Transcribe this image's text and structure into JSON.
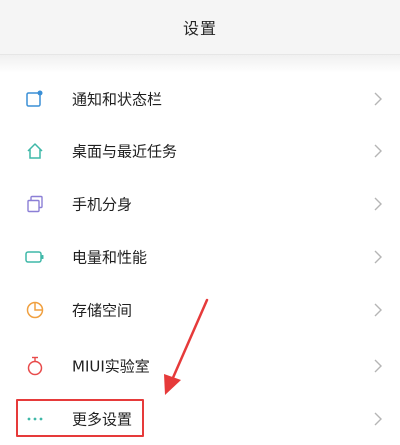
{
  "header": {
    "title": "设置"
  },
  "items": [
    {
      "label": "通知和状态栏",
      "icon": "notification-square-icon"
    },
    {
      "label": "桌面与最近任务",
      "icon": "home-icon"
    },
    {
      "label": "手机分身",
      "icon": "dual-copy-icon"
    },
    {
      "label": "电量和性能",
      "icon": "battery-icon"
    },
    {
      "label": "存储空间",
      "icon": "storage-pie-icon"
    },
    {
      "label": "MIUI实验室",
      "icon": "flask-icon"
    },
    {
      "label": "更多设置",
      "icon": "more-dots-icon"
    }
  ],
  "colors": {
    "accent": "#3fb8c8",
    "orange": "#f0a040",
    "red": "#e84a4a",
    "purple": "#8b7fd6",
    "annotation": "#e63a3a"
  }
}
